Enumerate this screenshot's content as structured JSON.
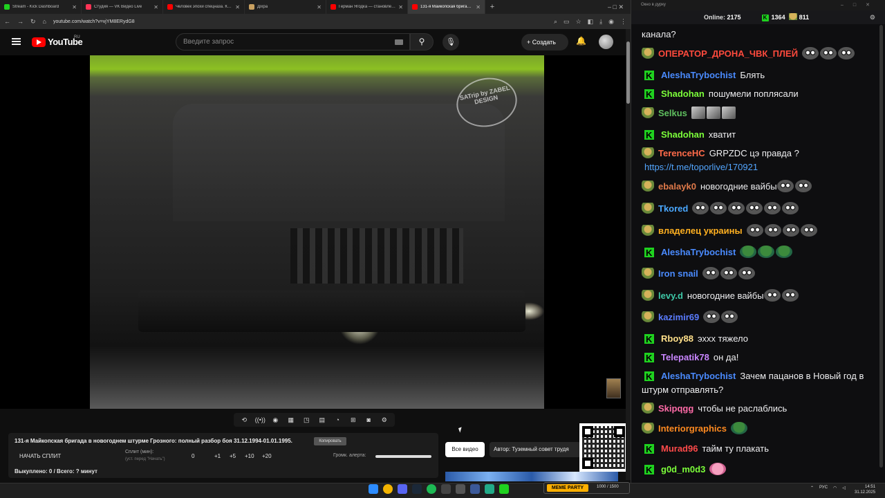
{
  "browser": {
    "tabs": [
      {
        "title": "Stream - Kick Dashboard",
        "color": "#1fd11f",
        "active": false
      },
      {
        "title": "Студия — VK Видео Live",
        "color": "#ff3355",
        "active": false
      },
      {
        "title": "Человек эпохи спецназа. Как…",
        "color": "#ff0000",
        "active": false
      },
      {
        "title": "Дiхра",
        "color": "#c8a060",
        "active": false
      },
      {
        "title": "Герман Ягодка — становлени…",
        "color": "#ff0000",
        "active": false
      },
      {
        "title": "131-я Майкопская брига…",
        "color": "#ff0000",
        "active": true
      }
    ],
    "new_tab": "+",
    "url": "youtube.com/watch?v=vjYM8ERydG8"
  },
  "youtube": {
    "logo_text": "YouTube",
    "region": "RU",
    "search_placeholder": "Введите запрос",
    "create_label": "Создать"
  },
  "video": {
    "watermark": "SATrip by ZABEL DESIGN"
  },
  "split_panel": {
    "title": "131-я Майкопская бригада в новогоднем штурме Грозного: полный разбор боя 31.12.1994-01.01.1995.",
    "copy_label": "Копировать",
    "start_label": "НАЧАТЬ СПЛИТ",
    "split_label": "Сплит (мин):",
    "split_hint": "(уст. перед \"Начать\")",
    "split_value": "0",
    "increments": [
      "+1",
      "+5",
      "+10",
      "+20"
    ],
    "volume_label": "Громк. алерта:",
    "volume_level": 1.0,
    "bought_text": "Выкуплено: 0 / Всего: ? минут"
  },
  "side_buttons": {
    "all_videos": "Все видео",
    "author": "Автор: Туземный совет трудя"
  },
  "chat_window": {
    "title": "Окно в дурку",
    "online_label": "Online:",
    "online_value": "2175",
    "kick_count": "1364",
    "vk_count": "811",
    "messages": [
      {
        "badge": "none",
        "nick": "",
        "nick_color": "#efeff1",
        "text": "канала?",
        "emotes": []
      },
      {
        "badge": "vk",
        "nick": "ОПЕРАТОР_ДРОНА_ЧВК_ПЛЕЙ",
        "nick_color": "#ff4a3d",
        "text": "",
        "emotes": [
          "cat",
          "cat",
          "cat"
        ]
      },
      {
        "badge": "kick",
        "nick": "AleshaTrybochist",
        "nick_color": "#4a8bff",
        "text": "Блять",
        "emotes": []
      },
      {
        "badge": "kick",
        "nick": "Shadohan",
        "nick_color": "#7cff3a",
        "text": "пошумели поплясали",
        "emotes": []
      },
      {
        "badge": "vk",
        "nick": "Selkus",
        "nick_color": "#5fbf5f",
        "text": "",
        "emotes": [
          "sq",
          "sq",
          "sq"
        ]
      },
      {
        "badge": "kick",
        "nick": "Shadohan",
        "nick_color": "#7cff3a",
        "text": "хватит",
        "emotes": []
      },
      {
        "badge": "vk",
        "nick": "TerenceHC",
        "nick_color": "#ff6b4a",
        "text": "GRPZDC цэ правда ?",
        "link": "https://t.me/toporlive/170921",
        "emotes": []
      },
      {
        "badge": "vk",
        "nick": "ebalayk0",
        "nick_color": "#e07a4a",
        "text": "новогодние вайбы",
        "emotes": [
          "cat",
          "cat"
        ]
      },
      {
        "badge": "vk",
        "nick": "Tkored",
        "nick_color": "#4aa8ff",
        "text": "",
        "emotes": [
          "cat",
          "cat",
          "cat",
          "cat",
          "cat",
          "cat"
        ]
      },
      {
        "badge": "vk",
        "nick": "владелец украины",
        "nick_color": "#ffb020",
        "text": "",
        "emotes": [
          "cat",
          "cat",
          "cat",
          "cat"
        ]
      },
      {
        "badge": "kick",
        "nick": "AleshaTrybochist",
        "nick_color": "#4a8bff",
        "text": "",
        "emotes": [
          "frog",
          "frog",
          "frog"
        ]
      },
      {
        "badge": "vk",
        "nick": "Iron snail",
        "nick_color": "#4a8bff",
        "text": "",
        "emotes": [
          "cat",
          "cat",
          "cat"
        ]
      },
      {
        "badge": "vk",
        "nick": "levy.d",
        "nick_color": "#3ec9a8",
        "text": "новогодние вайбы",
        "emotes": [
          "cat",
          "cat"
        ]
      },
      {
        "badge": "vk",
        "nick": "kazimir69",
        "nick_color": "#5a7cff",
        "text": "",
        "emotes": [
          "cat",
          "cat"
        ]
      },
      {
        "badge": "kick",
        "nick": "Rboy88",
        "nick_color": "#ffe08a",
        "text": "эхxx тяжело",
        "emotes": []
      },
      {
        "badge": "kick",
        "nick": "Telepatik78",
        "nick_color": "#c986ff",
        "text": "он да!",
        "emotes": []
      },
      {
        "badge": "kick",
        "nick": "AleshaTrybochist",
        "nick_color": "#4a8bff",
        "text": "Зачем пацанов в Новый год в штурм отправлять?",
        "emotes": []
      },
      {
        "badge": "vk",
        "nick": "Skipqgg",
        "nick_color": "#ff6ba8",
        "text": "чтобы не раслаблись",
        "emotes": []
      },
      {
        "badge": "vk",
        "nick": "Interiorgraphics",
        "nick_color": "#ff8a20",
        "text": "",
        "emotes": [
          "frog"
        ]
      },
      {
        "badge": "kick",
        "nick": "Murad96",
        "nick_color": "#ff4a4a",
        "text": "тайм ту плакать",
        "emotes": []
      },
      {
        "badge": "kick",
        "nick": "g0d_m0d3",
        "nick_color": "#7cff3a",
        "text": "",
        "emotes": [
          "pink"
        ]
      }
    ]
  },
  "taskbar": {
    "meme_party": "MEME PARTY",
    "meme_count": "1000 / 1500",
    "lang": "РУС",
    "time": "14:51",
    "date": "31.12.2025"
  }
}
